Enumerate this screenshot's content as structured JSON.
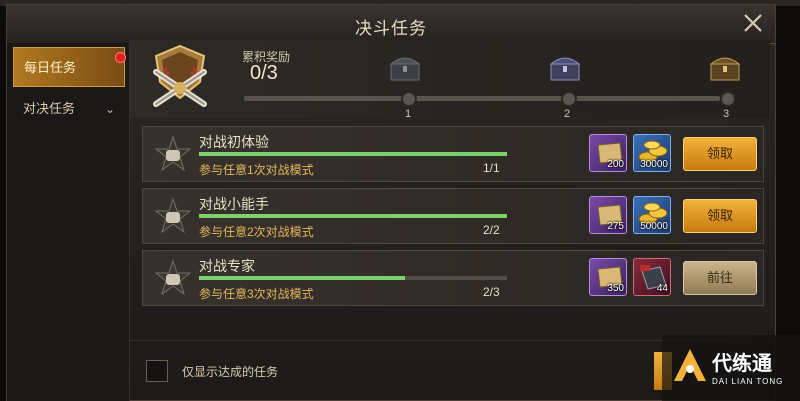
{
  "window": {
    "title": "决斗任务"
  },
  "sidebar": {
    "items": [
      {
        "label": "每日任务",
        "active": true,
        "has_badge": true
      },
      {
        "label": "对决任务",
        "active": false
      }
    ]
  },
  "rewards": {
    "label": "累积奖励",
    "value": "0/3",
    "progress": 0,
    "milestones": [
      "1",
      "2",
      "3"
    ]
  },
  "quests": [
    {
      "name": "对战初体验",
      "desc": "参与任意1次对战模式",
      "progress": "1/1",
      "fill": 1.0,
      "rewards": [
        {
          "icon": "ticket-icon",
          "count": "200"
        },
        {
          "icon": "gold-coins-icon",
          "count": "30000"
        }
      ],
      "button": "领取",
      "button_type": "claim"
    },
    {
      "name": "对战小能手",
      "desc": "参与任意2次对战模式",
      "progress": "2/2",
      "fill": 1.0,
      "rewards": [
        {
          "icon": "ticket-icon",
          "count": "275"
        },
        {
          "icon": "gold-coins-icon",
          "count": "50000"
        }
      ],
      "button": "领取",
      "button_type": "claim"
    },
    {
      "name": "对战专家",
      "desc": "参与任意3次对战模式",
      "progress": "2/3",
      "fill": 0.67,
      "rewards": [
        {
          "icon": "ticket-icon",
          "count": "350"
        },
        {
          "icon": "item-box-icon",
          "count": "44"
        }
      ],
      "button": "前往",
      "button_type": "go"
    }
  ],
  "footer": {
    "checkbox_label": "仅显示达成的任务",
    "checked": false
  },
  "watermark": {
    "text": "代练通",
    "sub": "DAI LIAN TONG"
  },
  "colors": {
    "accent": "#e0a030",
    "progress_fill": "#7ed06a",
    "badge_red": "#e02020"
  }
}
